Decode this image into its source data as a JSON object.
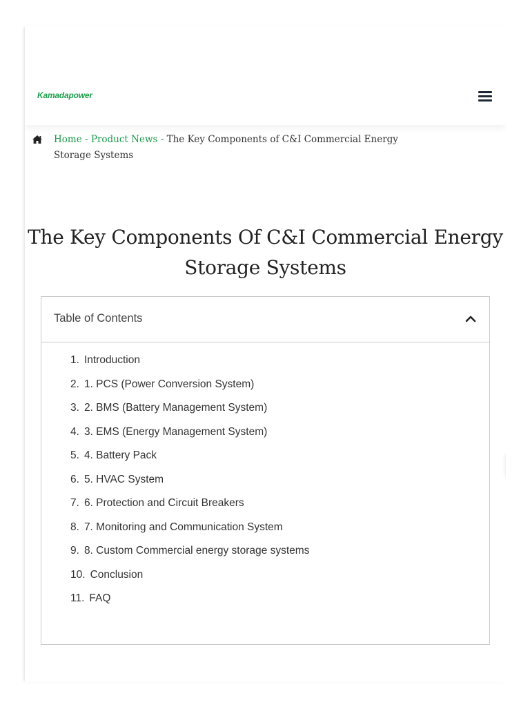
{
  "header": {
    "logo_text": "Kamadapower",
    "menu_icon": "hamburger-icon"
  },
  "breadcrumb": {
    "home_icon": "home-icon",
    "items": [
      {
        "label": "Home"
      },
      {
        "label": "Product News"
      }
    ],
    "separator": "-",
    "current": "The Key Components of C&I Commercial Energy Storage Systems"
  },
  "article": {
    "title": "The Key Components Of C&I Commercial Energy Storage Systems"
  },
  "toc": {
    "title": "Table of Contents",
    "toggle_icon": "chevron-up-icon",
    "items": [
      {
        "num": "1.",
        "label": "Introduction"
      },
      {
        "num": "2.",
        "label": "1. PCS (Power Conversion System)"
      },
      {
        "num": "3.",
        "label": "2. BMS (Battery Management System)"
      },
      {
        "num": "4.",
        "label": "3. EMS (Energy Management System)"
      },
      {
        "num": "5.",
        "label": "4. Battery Pack"
      },
      {
        "num": "6.",
        "label": "5. HVAC System"
      },
      {
        "num": "7.",
        "label": "6. Protection and Circuit Breakers"
      },
      {
        "num": "8.",
        "label": "7. Monitoring and Communication System"
      },
      {
        "num": "9.",
        "label": "8. Custom Commercial energy storage systems"
      },
      {
        "num": "10.",
        "label": "Conclusion"
      },
      {
        "num": "11.",
        "label": "FAQ"
      }
    ]
  },
  "colors": {
    "brand_green": "#1fa04d",
    "link_green": "#1d9a4b",
    "dark_icon": "#1d2733"
  }
}
